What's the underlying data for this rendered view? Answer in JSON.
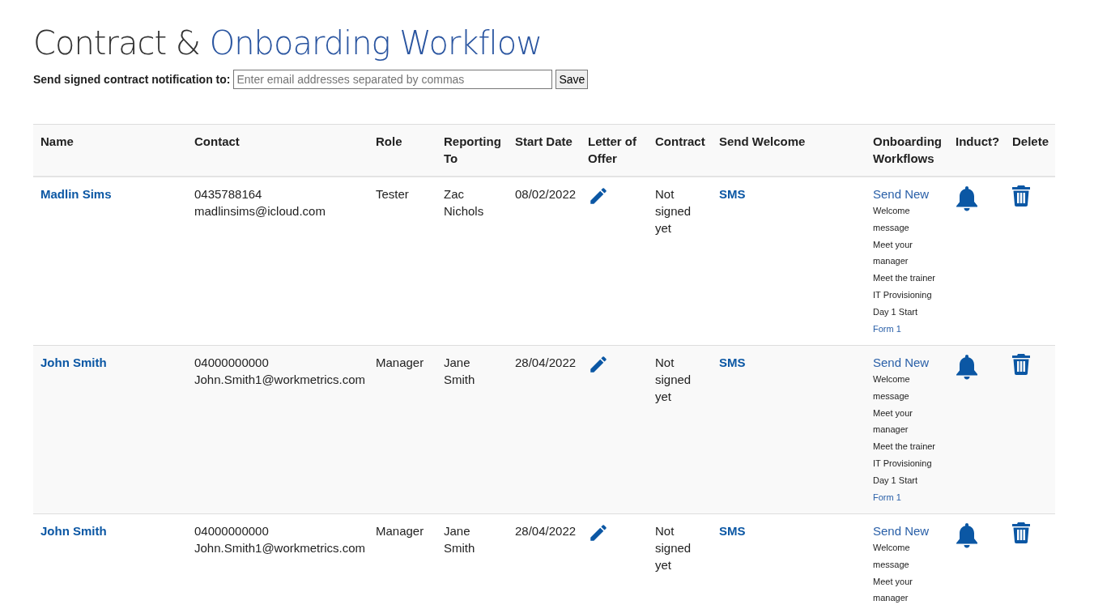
{
  "title": {
    "main": "Contract &",
    "accent": "Onboarding Workflow"
  },
  "notification": {
    "label": "Send signed contract notification to:",
    "placeholder": "Enter email addresses separated by commas",
    "button": "Save"
  },
  "table": {
    "columns": [
      "Name",
      "Contact",
      "Role",
      "Reporting To",
      "Start Date",
      "Letter of Offer",
      "Contract",
      "Send Welcome",
      "Onboarding Workflows",
      "Induct?",
      "Delete"
    ],
    "rows": [
      {
        "name": "Madlin Sims",
        "phone": "0435788164",
        "email": "madlinsims@icloud.com",
        "role": "Tester",
        "reporting_to": "Zac Nichols",
        "start_date": "08/02/2022",
        "contract": "Not signed yet",
        "send_welcome": "SMS",
        "send_new": "Send New",
        "workflows": [
          "Welcome message",
          "Meet your manager",
          "Meet the trainer",
          "IT Provisioning",
          "Day 1 Start"
        ],
        "form": "Form 1"
      },
      {
        "name": "John Smith",
        "phone": "04000000000",
        "email": "John.Smith1@workmetrics.com",
        "role": "Manager",
        "reporting_to": "Jane Smith",
        "start_date": "28/04/2022",
        "contract": "Not signed yet",
        "send_welcome": "SMS",
        "send_new": "Send New",
        "workflows": [
          "Welcome message",
          "Meet your manager",
          "Meet the trainer",
          "IT Provisioning",
          "Day 1 Start"
        ],
        "form": "Form 1"
      },
      {
        "name": "John Smith",
        "phone": "04000000000",
        "email": "John.Smith1@workmetrics.com",
        "role": "Manager",
        "reporting_to": "Jane Smith",
        "start_date": "28/04/2022",
        "contract": "Not signed yet",
        "send_welcome": "SMS",
        "send_new": "Send New",
        "workflows": [
          "Welcome message",
          "Meet your manager"
        ]
      }
    ]
  }
}
